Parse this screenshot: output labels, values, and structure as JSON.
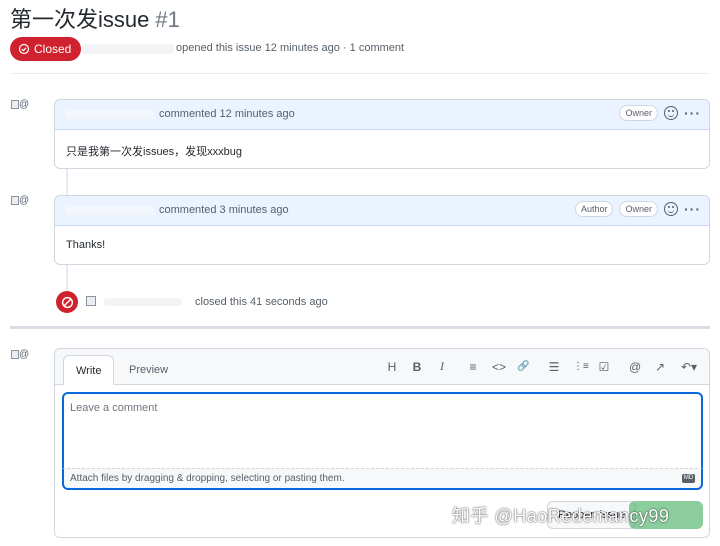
{
  "issue": {
    "title": "第一次发issue",
    "number": "#1",
    "state_label": "Closed",
    "meta": "opened this issue 12 minutes ago · 1 comment"
  },
  "comments": [
    {
      "time": "commented 12 minutes ago",
      "badges": [
        "Owner"
      ],
      "body": "只是我第一次发issues，发现xxxbug"
    },
    {
      "time": "commented 3 minutes ago",
      "badges": [
        "Author",
        "Owner"
      ],
      "body": "Thanks!"
    }
  ],
  "event": {
    "text": "closed this 41 seconds ago"
  },
  "avatar_alt": "@",
  "editor": {
    "tabs": [
      "Write",
      "Preview"
    ],
    "toolbar": {
      "heading": "H",
      "bold": "B",
      "italic": "I",
      "quote": "≡",
      "code": "<>",
      "link": "🔗",
      "bullet_list": "☰",
      "numbered_list": "⋮≡",
      "task_list": "☑",
      "mention": "@",
      "reference": "↗",
      "reply": "↶▾"
    },
    "placeholder": "Leave a comment",
    "attach_hint": "Attach files by dragging & dropping, selecting or pasting them.",
    "markdown_label": "MD",
    "reopen_label": "Reopen issue",
    "comment_label": "Comment"
  },
  "watermark": "知乎 @HaoRedemancy99",
  "colors": {
    "closed": "#cf222e",
    "accent": "#0969da",
    "header_bg": "#eaf3ff",
    "comment_btn": "#2da44e"
  }
}
